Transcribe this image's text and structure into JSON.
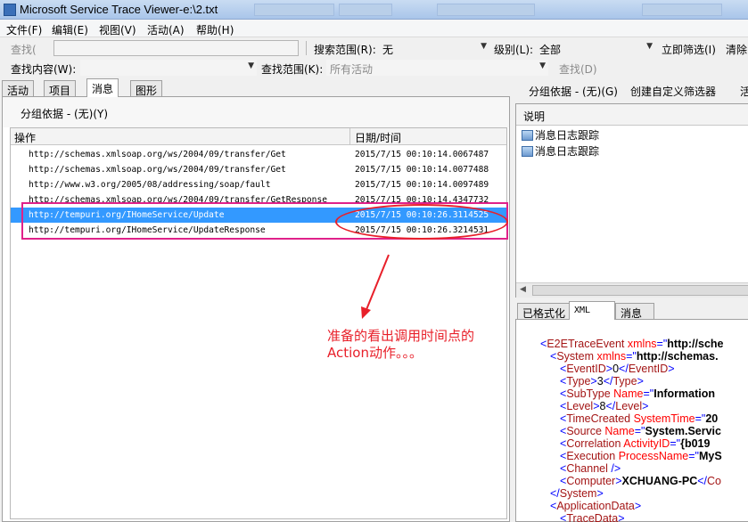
{
  "window": {
    "title": "Microsoft Service Trace Viewer-e:\\2.txt"
  },
  "menu": {
    "items": [
      "文件(F)",
      "编辑(E)",
      "视图(V)",
      "活动(A)",
      "帮助(H)"
    ]
  },
  "toolbar1": {
    "find_label": "查找(",
    "search_scope_label": "搜索范围(R):",
    "search_scope_value": "无",
    "level_label": "级别(L):",
    "level_value": "全部",
    "filter_now": "立即筛选(I)",
    "clear": "清除"
  },
  "toolbar2": {
    "find_what_label": "查找内容(W):",
    "look_in_label": "查找范围(K):",
    "look_in_value": "所有活动",
    "find_button": "查找(D)"
  },
  "left_tabs": [
    "活动",
    "项目",
    "消息",
    "图形"
  ],
  "left_tab_active": "消息",
  "right_toolbar": {
    "group_by": "分组依据 - (无)(G)",
    "create_filter": "创建自定义筛选器",
    "extra": "活"
  },
  "left_panel": {
    "group_by": "分组依据 - (无)(Y)",
    "columns": [
      "操作",
      "日期/时间"
    ],
    "rows": [
      {
        "action": "http://schemas.xmlsoap.org/ws/2004/09/transfer/Get",
        "time": "2015/7/15 00:10:14.0067487",
        "selected": false
      },
      {
        "action": "http://schemas.xmlsoap.org/ws/2004/09/transfer/Get",
        "time": "2015/7/15 00:10:14.0077488",
        "selected": false
      },
      {
        "action": "http://www.w3.org/2005/08/addressing/soap/fault",
        "time": "2015/7/15 00:10:14.0097489",
        "selected": false
      },
      {
        "action": "http://schemas.xmlsoap.org/ws/2004/09/transfer/GetResponse",
        "time": "2015/7/15 00:10:14.4347732",
        "selected": false
      },
      {
        "action": "http://tempuri.org/IHomeService/Update",
        "time": "2015/7/15 00:10:26.3114525",
        "selected": true
      },
      {
        "action": "http://tempuri.org/IHomeService/UpdateResponse",
        "time": "2015/7/15 00:10:26.3214531",
        "selected": false
      }
    ]
  },
  "annotation": {
    "line1": "准备的看出调用时间点的",
    "line2": "Action动作。。。",
    "color": "#e8202a"
  },
  "right_panel": {
    "header": "说明",
    "items": [
      "消息日志跟踪",
      "消息日志跟踪"
    ]
  },
  "bottom_tabs": [
    "已格式化",
    "XML",
    "消息"
  ],
  "bottom_tab_active": "XML",
  "xml_lines": [
    {
      "indent": 0,
      "parts": [
        [
          "b",
          "<"
        ],
        [
          "t",
          "E2ETraceEvent"
        ],
        [
          "a",
          " xmlns"
        ],
        [
          "b",
          "=\""
        ],
        [
          "v",
          "http://sche"
        ]
      ]
    },
    {
      "indent": 1,
      "parts": [
        [
          "b",
          "<"
        ],
        [
          "t",
          "System"
        ],
        [
          "a",
          " xmlns"
        ],
        [
          "b",
          "=\""
        ],
        [
          "v",
          "http://schemas."
        ]
      ]
    },
    {
      "indent": 2,
      "parts": [
        [
          "b",
          "<"
        ],
        [
          "t",
          "EventID"
        ],
        [
          "b",
          ">"
        ],
        [
          "x",
          "0"
        ],
        [
          "b",
          "</"
        ],
        [
          "t",
          "EventID"
        ],
        [
          "b",
          ">"
        ]
      ]
    },
    {
      "indent": 2,
      "parts": [
        [
          "b",
          "<"
        ],
        [
          "t",
          "Type"
        ],
        [
          "b",
          ">"
        ],
        [
          "x",
          "3"
        ],
        [
          "b",
          "</"
        ],
        [
          "t",
          "Type"
        ],
        [
          "b",
          ">"
        ]
      ]
    },
    {
      "indent": 2,
      "parts": [
        [
          "b",
          "<"
        ],
        [
          "t",
          "SubType"
        ],
        [
          "a",
          " Name"
        ],
        [
          "b",
          "=\""
        ],
        [
          "v",
          "Information"
        ]
      ]
    },
    {
      "indent": 2,
      "parts": [
        [
          "b",
          "<"
        ],
        [
          "t",
          "Level"
        ],
        [
          "b",
          ">"
        ],
        [
          "x",
          "8"
        ],
        [
          "b",
          "</"
        ],
        [
          "t",
          "Level"
        ],
        [
          "b",
          ">"
        ]
      ]
    },
    {
      "indent": 2,
      "parts": [
        [
          "b",
          "<"
        ],
        [
          "t",
          "TimeCreated"
        ],
        [
          "a",
          " SystemTime"
        ],
        [
          "b",
          "=\""
        ],
        [
          "v",
          "20"
        ]
      ]
    },
    {
      "indent": 2,
      "parts": [
        [
          "b",
          "<"
        ],
        [
          "t",
          "Source"
        ],
        [
          "a",
          " Name"
        ],
        [
          "b",
          "=\""
        ],
        [
          "v",
          "System.Servic"
        ]
      ]
    },
    {
      "indent": 2,
      "parts": [
        [
          "b",
          "<"
        ],
        [
          "t",
          "Correlation"
        ],
        [
          "a",
          " ActivityID"
        ],
        [
          "b",
          "=\""
        ],
        [
          "v",
          "{b019"
        ]
      ]
    },
    {
      "indent": 2,
      "parts": [
        [
          "b",
          "<"
        ],
        [
          "t",
          "Execution"
        ],
        [
          "a",
          " ProcessName"
        ],
        [
          "b",
          "=\""
        ],
        [
          "v",
          "MyS"
        ]
      ]
    },
    {
      "indent": 2,
      "parts": [
        [
          "b",
          "<"
        ],
        [
          "t",
          "Channel"
        ],
        [
          "b",
          " />"
        ]
      ]
    },
    {
      "indent": 2,
      "parts": [
        [
          "b",
          "<"
        ],
        [
          "t",
          "Computer"
        ],
        [
          "b",
          ">"
        ],
        [
          "v",
          "XCHUANG-PC"
        ],
        [
          "b",
          "</"
        ],
        [
          "t",
          "Co"
        ]
      ]
    },
    {
      "indent": 1,
      "parts": [
        [
          "b",
          "</"
        ],
        [
          "t",
          "System"
        ],
        [
          "b",
          ">"
        ]
      ]
    },
    {
      "indent": 1,
      "parts": [
        [
          "b",
          "<"
        ],
        [
          "t",
          "ApplicationData"
        ],
        [
          "b",
          ">"
        ]
      ]
    },
    {
      "indent": 2,
      "parts": [
        [
          "b",
          "<"
        ],
        [
          "t",
          "TraceData"
        ],
        [
          "b",
          ">"
        ]
      ]
    }
  ]
}
